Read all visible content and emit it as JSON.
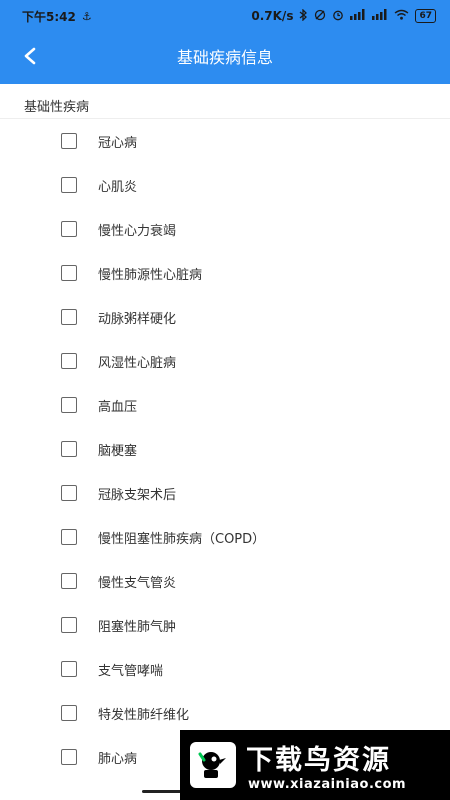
{
  "status_bar": {
    "time": "下午5:42",
    "app_indicator": "⚓",
    "network_speed": "0.7K/s",
    "battery": "67"
  },
  "header": {
    "title": "基础疾病信息",
    "back_icon": "chevron-left-icon"
  },
  "section": {
    "title": "基础性疾病"
  },
  "conditions": [
    {
      "label": "冠心病",
      "checked": false
    },
    {
      "label": "心肌炎",
      "checked": false
    },
    {
      "label": "慢性心力衰竭",
      "checked": false
    },
    {
      "label": "慢性肺源性心脏病",
      "checked": false
    },
    {
      "label": "动脉粥样硬化",
      "checked": false
    },
    {
      "label": "风湿性心脏病",
      "checked": false
    },
    {
      "label": "高血压",
      "checked": false
    },
    {
      "label": "脑梗塞",
      "checked": false
    },
    {
      "label": "冠脉支架术后",
      "checked": false
    },
    {
      "label": "慢性阻塞性肺疾病（COPD）",
      "checked": false
    },
    {
      "label": "慢性支气管炎",
      "checked": false
    },
    {
      "label": "阻塞性肺气肿",
      "checked": false
    },
    {
      "label": "支气管哮喘",
      "checked": false
    },
    {
      "label": "特发性肺纤维化",
      "checked": false
    },
    {
      "label": "肺心病",
      "checked": false
    }
  ],
  "watermark": {
    "text": "下载鸟资源",
    "url": "www.xiazainiao.com"
  },
  "colors": {
    "primary": "#2D8CF0",
    "text": "#333333",
    "checkbox_border": "#666666"
  }
}
